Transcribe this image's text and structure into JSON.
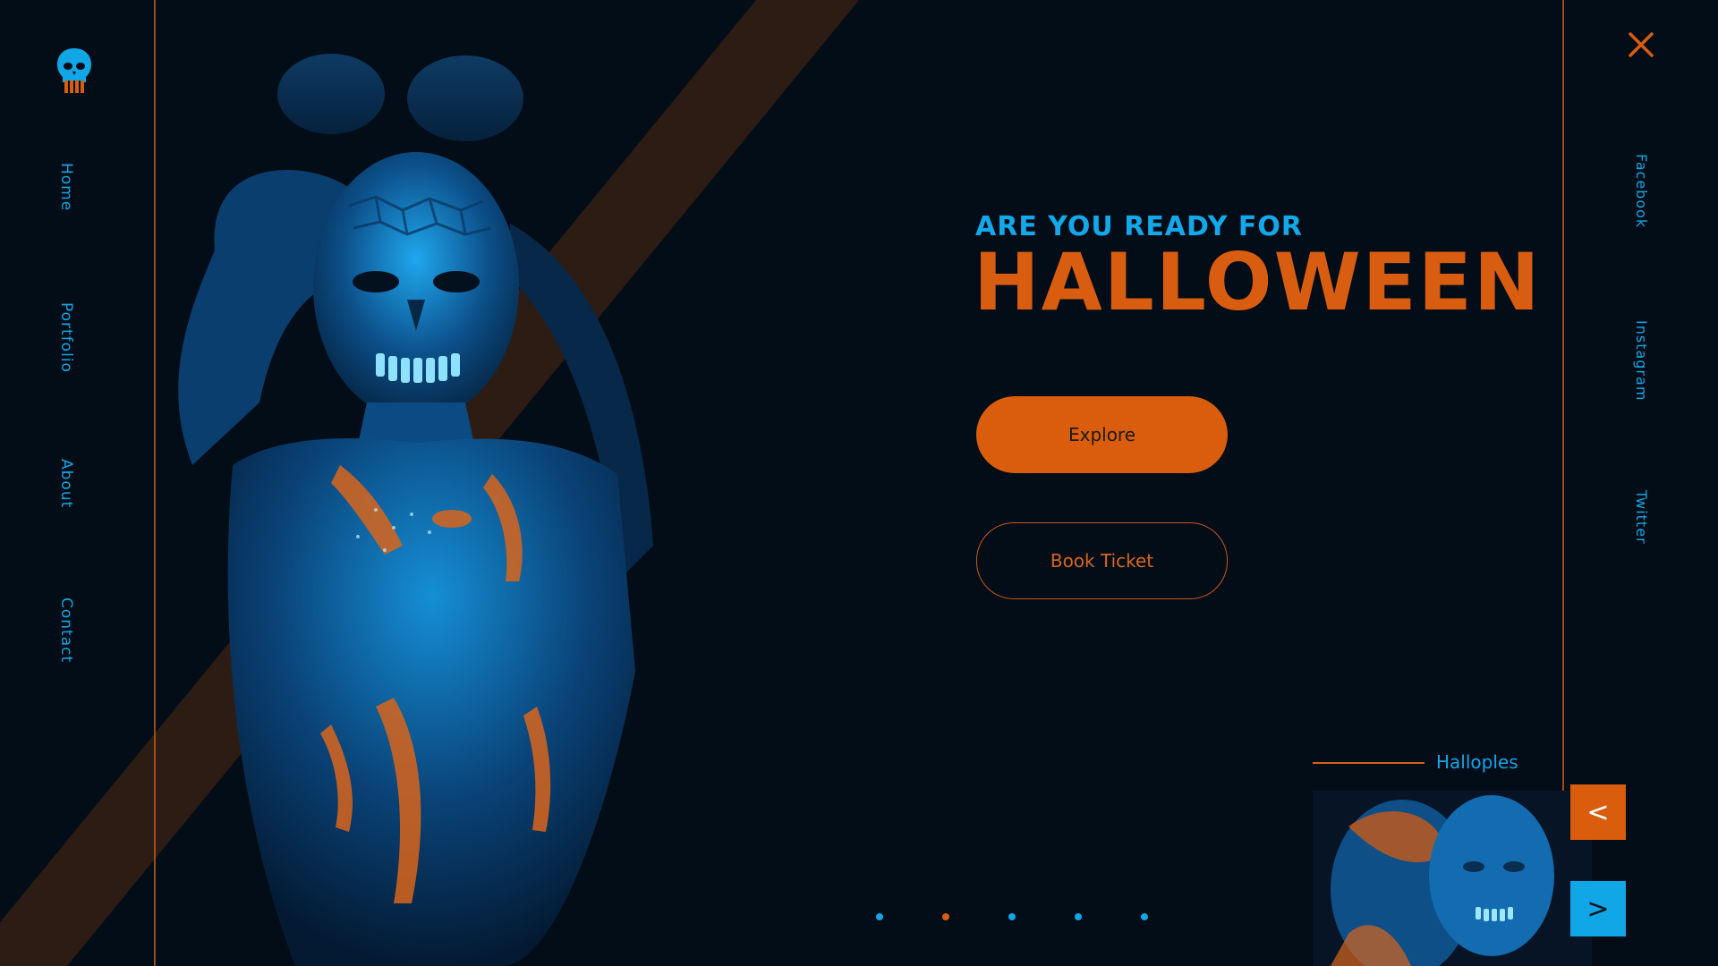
{
  "brand": {
    "logo_icon": "skull-icon",
    "colors": {
      "background": "#030d17",
      "accent_orange": "#d95d10",
      "accent_blue": "#11a6e6",
      "stripe_brown": "#2d1c14"
    }
  },
  "nav": {
    "items": [
      {
        "label": "Home"
      },
      {
        "label": "Portfolio"
      },
      {
        "label": "About"
      },
      {
        "label": "Contact"
      }
    ]
  },
  "social": {
    "items": [
      {
        "label": "Facebook"
      },
      {
        "label": "Instagram"
      },
      {
        "label": "Twitter"
      }
    ]
  },
  "close_icon": "close-icon",
  "hero": {
    "subtitle": "ARE YOU READY FOR",
    "title": "HALLOWEEN",
    "primary_button": "Explore",
    "secondary_button": "Book Ticket"
  },
  "carousel": {
    "dots": [
      {
        "active": false
      },
      {
        "active": true
      },
      {
        "active": false
      },
      {
        "active": false
      },
      {
        "active": false
      }
    ],
    "thumbnail_label": "Halloples",
    "prev_label": "<",
    "next_label": ">"
  }
}
